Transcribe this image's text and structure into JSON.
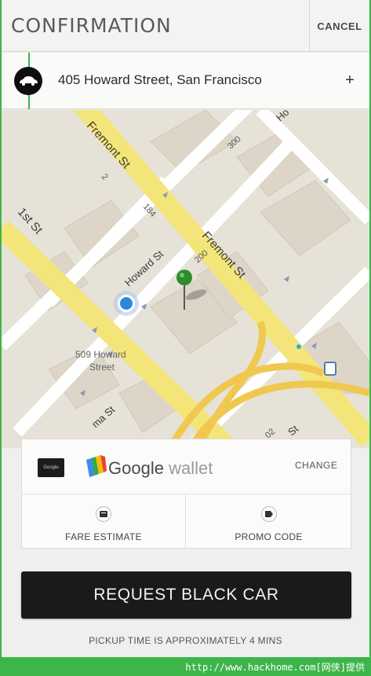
{
  "header": {
    "title": "CONFIRMATION",
    "cancel_label": "CANCEL"
  },
  "address": {
    "text": "405 Howard Street, San Francisco",
    "add_label": "+",
    "car_icon": "car-icon"
  },
  "map": {
    "labels": {
      "fremont_top": "Fremont St",
      "fremont_mid": "Fremont St",
      "first_st": "1st St",
      "howard_st": "Howard St",
      "howard_top": "Ho",
      "building_509": "509 Howard",
      "building_509_b": "Street",
      "ma_st": "ma St",
      "st_right": "St",
      "num_300": "300",
      "num_200": "200",
      "num_184": "184",
      "num_2": "2",
      "num_02": "02"
    },
    "colors": {
      "road_yellow": "#f6e87a",
      "road_white": "#ffffff",
      "block": "#e8e4da",
      "pin": "#2e8b2e",
      "location_dot": "#2a8ad8"
    }
  },
  "payment": {
    "wallet_brand": "Google",
    "wallet_suffix": " wallet",
    "card_text": "Google",
    "change_label": "CHANGE"
  },
  "options": {
    "fare_estimate": "FARE ESTIMATE",
    "promo_code": "PROMO CODE"
  },
  "request": {
    "label": "REQUEST BLACK CAR",
    "pickup_text": "PICKUP TIME IS APPROXIMATELY 4 MINS"
  },
  "watermark": {
    "text": "http://www.hackhome.com[网侠]提供"
  }
}
